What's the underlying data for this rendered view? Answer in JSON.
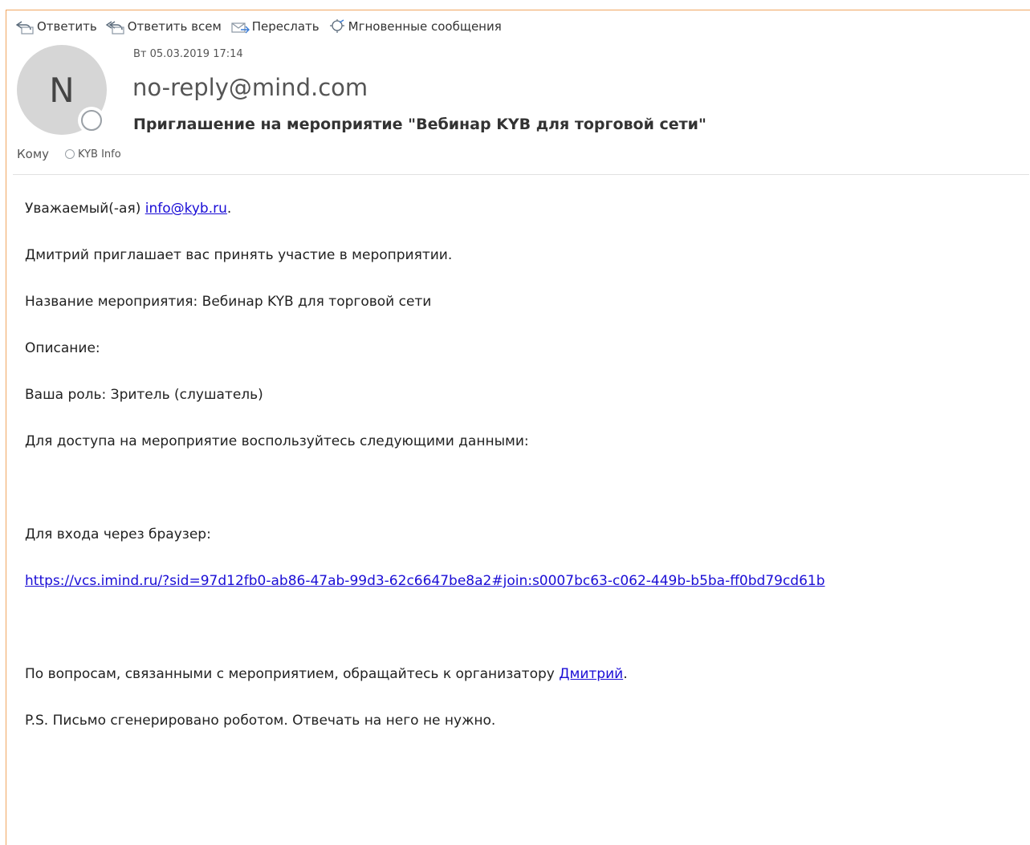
{
  "toolbar": {
    "reply": "Ответить",
    "reply_all": "Ответить всем",
    "forward": "Переслать",
    "im": "Мгновенные сообщения"
  },
  "header": {
    "avatar_letter": "N",
    "date": "Вт 05.03.2019 17:14",
    "sender": "no-reply@mind.com",
    "subject": "Приглашение на мероприятие \"Вебинар KYB для торговой сети\"",
    "to_label": "Кому",
    "recipient": "KYB Info"
  },
  "body": {
    "greeting_prefix": "Уважаемый(-ая) ",
    "greeting_email": "info@kyb.ru",
    "greeting_suffix": ".",
    "invite": "Дмитрий приглашает вас принять участие в мероприятии.",
    "event_name": "Название мероприятия: Вебинар KYB для торговой сети",
    "description": "Описание:",
    "role": "Ваша роль: Зритель (слушатель)",
    "access": "Для доступа на мероприятие воспользуйтесь следующими данными:",
    "browser": "Для входа через браузер:",
    "link": "https://vcs.imind.ru/?sid=97d12fb0-ab86-47ab-99d3-62c6647be8a2#join:s0007bc63-c062-449b-b5ba-ff0bd79cd61b",
    "questions_prefix": "По вопросам, связанными с мероприятием, обращайтесь к организатору ",
    "organizer": "Дмитрий",
    "questions_suffix": ".",
    "ps": "P.S. Письмо сгенерировано роботом. Отвечать на него не нужно."
  },
  "colors": {
    "frame_border": "#f0a560",
    "link": "#1a0dd6",
    "avatar_bg": "#d6d6d6"
  },
  "icons": {
    "reply": "reply-icon",
    "reply_all": "reply-all-icon",
    "forward": "forward-icon",
    "im": "instant-message-icon"
  }
}
